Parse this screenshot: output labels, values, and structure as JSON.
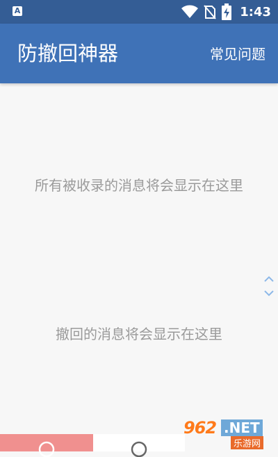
{
  "status_bar": {
    "app_icon_letter": "A",
    "time": "1:43",
    "icons": [
      "wifi-icon",
      "no-sim-icon",
      "battery-charging-icon"
    ]
  },
  "app_bar": {
    "title": "防撤回神器",
    "faq_label": "常见问题"
  },
  "main": {
    "all_messages_empty": "所有被收录的消息将会显示在这里",
    "recalled_messages_empty": "撤回的消息将会显示在这里"
  },
  "watermark": {
    "number": "962",
    "suffix": ".NET",
    "site_name": "乐游网"
  },
  "colors": {
    "status_bar": "#345d95",
    "app_bar": "#3f72b7",
    "empty_text": "#9a9a9a",
    "bottom_tab_active": "#f0908f"
  }
}
